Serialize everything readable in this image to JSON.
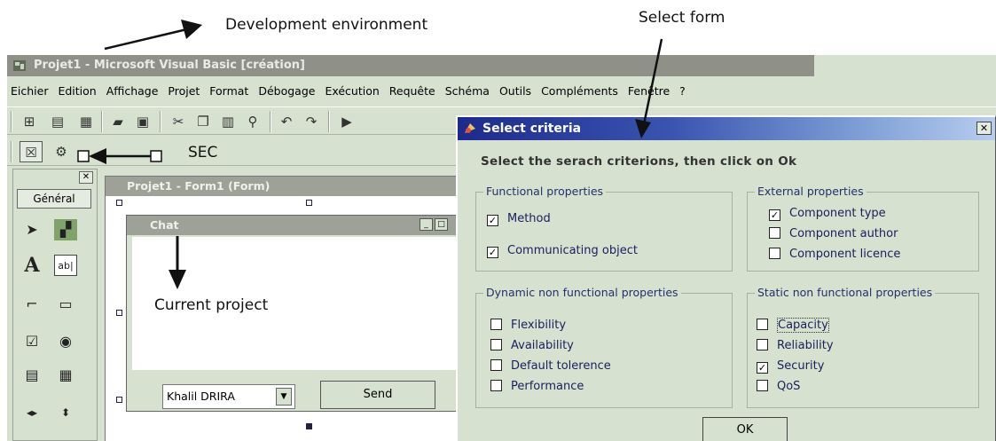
{
  "annotations": {
    "development_environment": "Development environment",
    "select_form": "Select form",
    "sec": "SEC",
    "current_project": "Current project"
  },
  "vb_window": {
    "title": "Projet1 - Microsoft Visual Basic [création]",
    "menu": [
      "Eichier",
      "Edition",
      "Affichage",
      "Projet",
      "Format",
      "Débogage",
      "Exécution",
      "Requête",
      "Schéma",
      "Outils",
      "Compléments",
      "Fenêtre",
      "?"
    ]
  },
  "toolbox": {
    "tab_label": "Général",
    "close_glyph": "✕"
  },
  "form_designer": {
    "title": "Projet1 - Form1 (Form)"
  },
  "chat_form": {
    "title": "Chat",
    "combo_value": "Khalil DRIRA",
    "send_label": "Send"
  },
  "dialog": {
    "title": "Select criteria",
    "close_glyph": "✕",
    "instruction": "Select the serach criterions, then click on Ok",
    "groups": {
      "functional": {
        "label": "Functional properties",
        "items": [
          {
            "label": "Method",
            "checked": true
          },
          {
            "label": "Communicating object",
            "checked": true
          }
        ]
      },
      "external": {
        "label": "External properties",
        "items": [
          {
            "label": "Component type",
            "checked": true
          },
          {
            "label": "Component author",
            "checked": false
          },
          {
            "label": "Component licence",
            "checked": false
          }
        ]
      },
      "dynamic": {
        "label": "Dynamic non functional properties",
        "items": [
          {
            "label": "Flexibility",
            "checked": false
          },
          {
            "label": "Availability",
            "checked": false
          },
          {
            "label": "Default tolerence",
            "checked": false
          },
          {
            "label": "Performance",
            "checked": false
          }
        ]
      },
      "static": {
        "label": "Static non functional properties",
        "items": [
          {
            "label": "Capacity",
            "checked": false
          },
          {
            "label": "Reliability",
            "checked": false
          },
          {
            "label": "Security",
            "checked": true
          },
          {
            "label": "QoS",
            "checked": false
          }
        ]
      }
    },
    "ok_label": "OK"
  },
  "colors": {
    "window_bg": "#d6e1cf",
    "titlebar_inactive": "#8f9189",
    "dialog_title_start": "#1c2a8e",
    "dialog_title_end": "#b7cdef",
    "group_text": "#1a1f5e"
  }
}
